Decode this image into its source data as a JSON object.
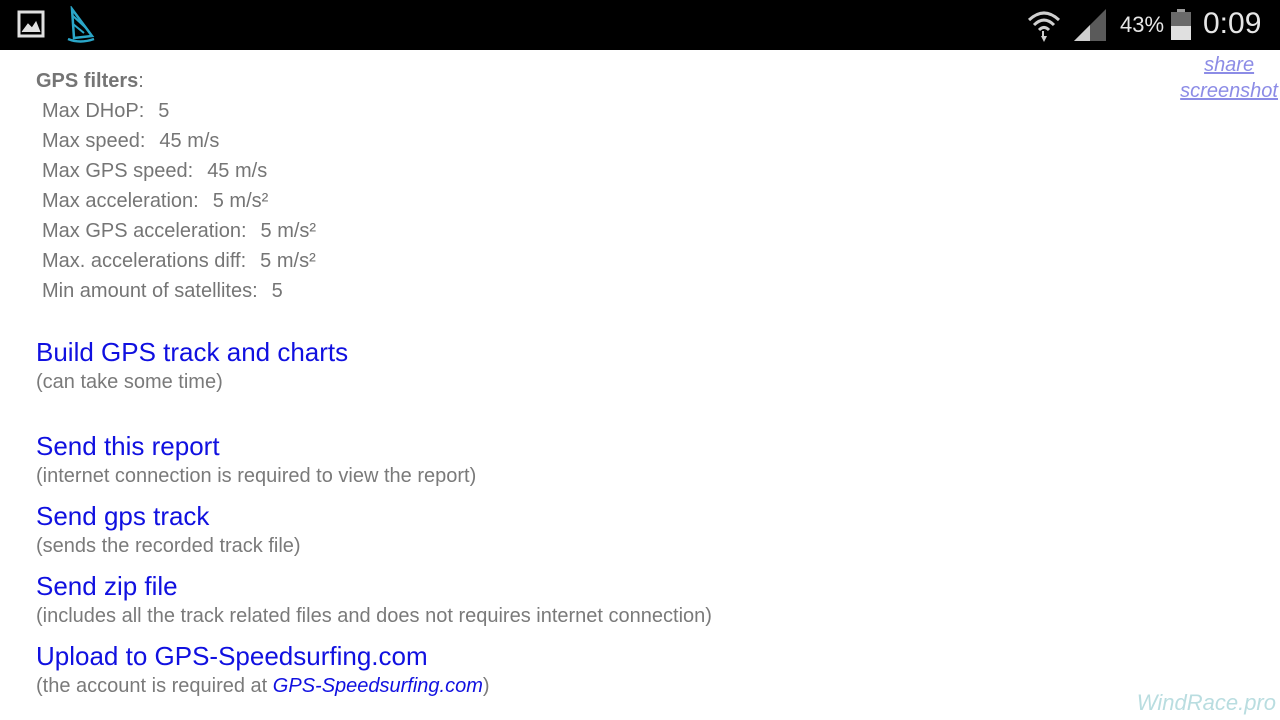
{
  "status_bar": {
    "battery_percent": "43%",
    "clock": "0:09",
    "icons": [
      "gallery-icon",
      "sail-icon",
      "wifi-icon",
      "signal-icon",
      "battery-icon"
    ]
  },
  "filters": {
    "title": "GPS filters",
    "title_suffix": ":",
    "rows": [
      {
        "label": "Max DHoP:",
        "value": "5"
      },
      {
        "label": "Max speed:",
        "value": "45 m/s"
      },
      {
        "label": "Max GPS speed:",
        "value": "45 m/s"
      },
      {
        "label": "Max acceleration:",
        "value": "5 m/s²"
      },
      {
        "label": "Max GPS acceleration:",
        "value": "5 m/s²"
      },
      {
        "label": "Max. accelerations diff:",
        "value": "5 m/s²"
      },
      {
        "label": "Min amount of satellites:",
        "value": "5"
      }
    ]
  },
  "share": {
    "line1": "share",
    "line2": "screenshot"
  },
  "actions": [
    {
      "label": "Build GPS track and charts",
      "note": "(can take some time)"
    },
    {
      "label": "Send this report",
      "note": "(internet connection is required to view the report)"
    },
    {
      "label": "Send gps track",
      "note": "(sends the recorded track file)"
    },
    {
      "label": "Send zip file",
      "note": "(includes all the track related files and does not requires internet connection)"
    },
    {
      "label": "Upload to GPS-Speedsurfing.com",
      "note_prefix": "(the account is required at ",
      "note_link": "GPS-Speedsurfing.com",
      "note_suffix": ")"
    }
  ],
  "watermark": "WindRace.pro",
  "colors": {
    "link": "#1010e0",
    "share_link": "#8c8ce6",
    "text_gray": "#757575",
    "watermark": "#b9dde0",
    "status_bar": "#000000"
  }
}
